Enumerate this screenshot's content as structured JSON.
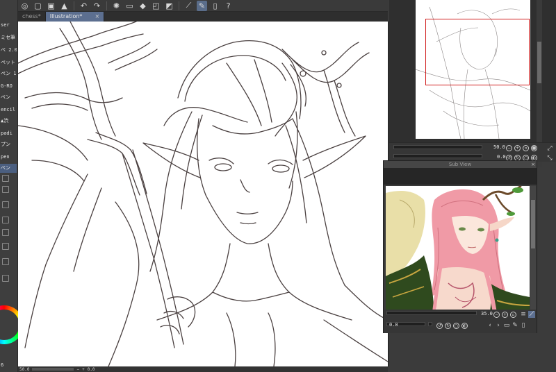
{
  "tabs": [
    {
      "label": "chess*",
      "active": false
    },
    {
      "label": "Illustration*",
      "active": true
    }
  ],
  "toolbar": {
    "icons": [
      "app-icon",
      "new-icon",
      "save-icon",
      "export-icon",
      "undo-icon",
      "redo-icon",
      "spinner-icon",
      "clear-icon",
      "fill-icon",
      "transform-icon",
      "selection-icon",
      "ruler-icon",
      "pen-icon",
      "device-icon",
      "help-icon"
    ]
  },
  "left_panel": {
    "items": [
      {
        "label": "ser",
        "selected": false
      },
      {
        "label": "ミセ筆",
        "selected": false
      },
      {
        "label": "ペ 2.0",
        "selected": false
      },
      {
        "label": "ペット",
        "selected": false
      },
      {
        "label": "ペン 1",
        "selected": false
      },
      {
        "label": "G-RO",
        "selected": false
      },
      {
        "label": "ペン",
        "selected": false
      },
      {
        "label": "encil",
        "selected": false
      },
      {
        "label": "▲渋",
        "selected": false
      },
      {
        "label": "padi",
        "selected": false
      },
      {
        "label": "プン",
        "selected": false
      },
      {
        "label": "pen",
        "selected": false
      },
      {
        "label": "ペン",
        "selected": true
      }
    ],
    "bottom_number": "6"
  },
  "status_bar": {
    "zoom": "50.0",
    "angle": "0.0"
  },
  "navigator": {
    "zoom_value": "50.0",
    "rotation_value": "0.0"
  },
  "subview": {
    "title": "Sub View",
    "zoom_value": "35.0",
    "rotation_value": "0.0"
  },
  "colors": {
    "panel_bg": "#3b3b3b",
    "accent": "#5c6f90",
    "navigator_frame": "#d01c1c",
    "line_art": "#4a4040"
  }
}
